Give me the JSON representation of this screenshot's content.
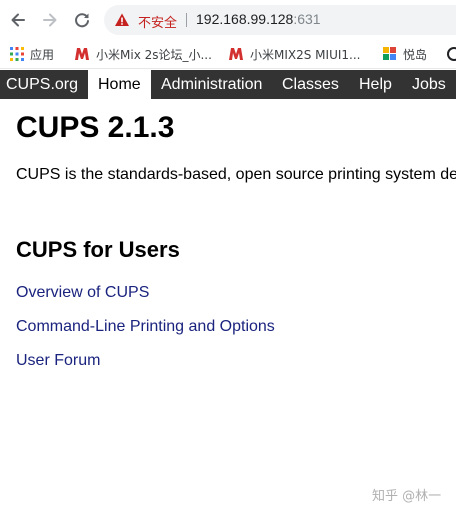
{
  "browser": {
    "security_label": "不安全",
    "url_host": "192.168.99.128",
    "url_port": ":631",
    "bookmarks": [
      {
        "label": "应用",
        "icon": "apps-grid-icon"
      },
      {
        "label": "小米Mix 2s论坛_小...",
        "icon": "miui-logo-icon"
      },
      {
        "label": "小米MIX2S MIUI1...",
        "icon": "miui-logo-icon"
      },
      {
        "label": "悦岛",
        "icon": "colorful-squares-icon"
      }
    ]
  },
  "cups_nav": {
    "tabs": [
      "CUPS.org",
      "Home",
      "Administration",
      "Classes",
      "Help",
      "Jobs"
    ],
    "active": "Home"
  },
  "main": {
    "title": "CUPS 2.1.3",
    "intro": "CUPS is the standards-based, open source printing system de",
    "users_heading": "CUPS for Users",
    "links": [
      "Overview of CUPS",
      "Command-Line Printing and Options",
      "User Forum"
    ]
  },
  "watermark": "知乎 @林一",
  "colors": {
    "nav_bg": "#333333",
    "link": "#1a237e",
    "insecure": "#c5221f"
  }
}
